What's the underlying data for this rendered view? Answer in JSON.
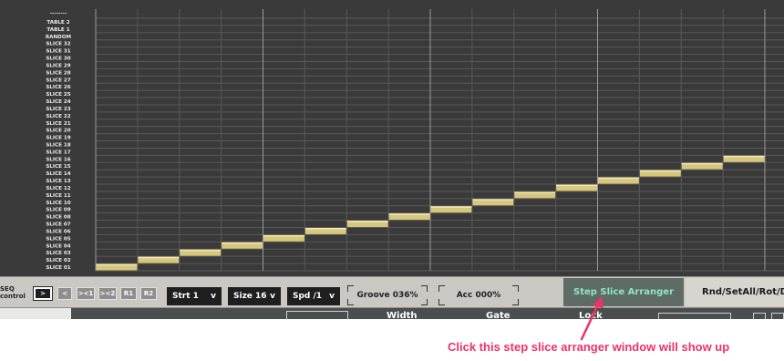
{
  "grid": {
    "top_label": "--------",
    "row_labels": [
      "TABLE 2",
      "TABLE 1",
      "RANDOM",
      "SLICE 32",
      "SLICE 31",
      "SLICE 30",
      "SLICE 29",
      "SLICE 28",
      "SLICE 27",
      "SLICE 26",
      "SLICE 25",
      "SLICE 24",
      "SLICE 23",
      "SLICE 22",
      "SLICE 21",
      "SLICE 20",
      "SLICE 19",
      "SLICE 18",
      "SLICE 17",
      "SLICE 16",
      "SLICE 15",
      "SLICE 14",
      "SLICE 13",
      "SLICE 12",
      "SLICE 11",
      "SLICE 10",
      "SLICE 09",
      "SLICE 08",
      "SLICE 07",
      "SLICE 06",
      "SLICE 05",
      "SLICE 04",
      "SLICE 03",
      "SLICE 02",
      "SLICE 01"
    ],
    "step_slices": [
      1,
      2,
      3,
      4,
      5,
      6,
      7,
      8,
      9,
      10,
      11,
      12,
      13,
      14,
      15,
      16
    ],
    "colors": {
      "background": "#3a3a3a",
      "grid_line": "#595959",
      "beat_line": "#9a9a9a",
      "step_bar": "#d7c77c"
    }
  },
  "controls": {
    "seq_label_line1": "SEQ",
    "seq_label_line2": "control",
    "transport_buttons": [
      ">",
      "<",
      "><1",
      "><2",
      "R1",
      "R2"
    ],
    "start": {
      "value": "Strt 1",
      "arrow": "v"
    },
    "size": {
      "value": "Size 16",
      "arrow": "v"
    },
    "speed": {
      "value": "Spd /1",
      "arrow": "v"
    },
    "groove": "Groove 036%",
    "accent": "Acc 000%"
  },
  "tabs": {
    "step_slice_arranger": "Step Slice Arranger",
    "rnd_set": "Rnd/SetAll/Rot/D"
  },
  "lower": {
    "word1": "Width",
    "word2": "Gate",
    "word3": "Lock"
  },
  "annotation": {
    "text": "Click this step slice arranger window will show up",
    "color": "#f0306a"
  }
}
